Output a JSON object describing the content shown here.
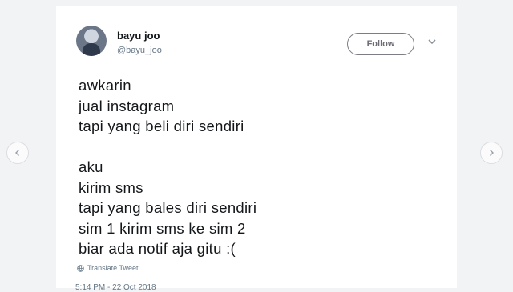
{
  "user": {
    "name": "bayu joo",
    "handle": "@bayu_joo"
  },
  "follow_label": "Follow",
  "tweet_lines": [
    "awkarin",
    "jual instagram",
    "tapi yang beli diri sendiri",
    "",
    "aku",
    "kirim sms",
    "tapi yang bales diri sendiri",
    "sim 1 kirim sms ke sim 2",
    "biar ada notif aja gitu :("
  ],
  "translate_label": "Translate Tweet",
  "timestamp": "5:14 PM - 22 Oct 2018",
  "icons": {
    "more": "chevron-down-icon",
    "translate": "globe-icon",
    "prev": "chevron-left-icon",
    "next": "chevron-right-icon"
  }
}
